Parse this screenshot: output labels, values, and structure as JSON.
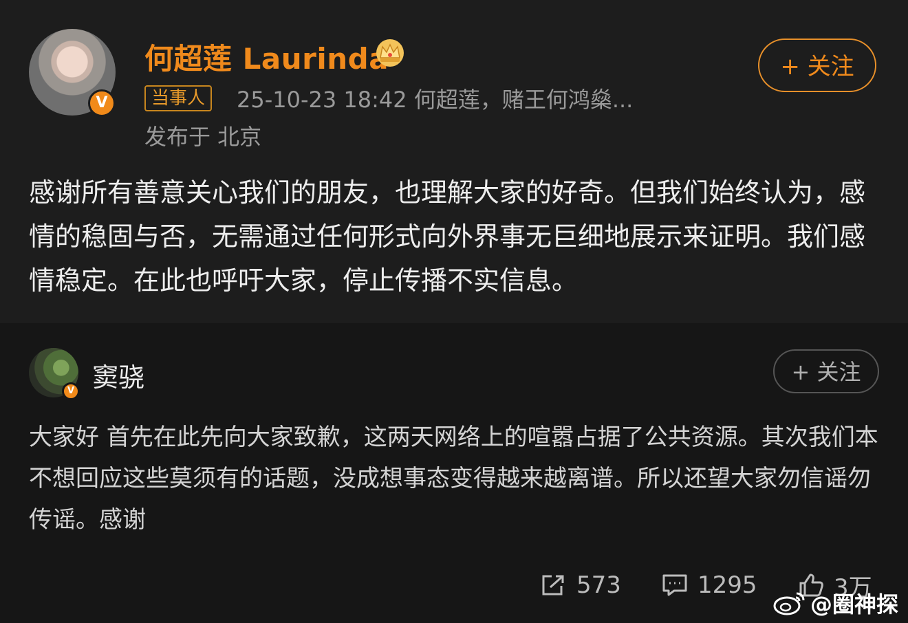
{
  "post": {
    "author_name": "何超莲 Laurinda",
    "tag": "当事人",
    "meta": "25-10-23 18:42  何超莲，赌王何鸿燊...",
    "location": "发布于 北京",
    "follow_label": "+ 关注",
    "text": "感谢所有善意关心我们的朋友，也理解大家的好奇。但我们始终认为，感情的稳固与否，无需通过任何形式向外界事无巨细地展示来证明。我们感情稳定。在此也呼吁大家，停止传播不实信息。",
    "verified_badge": "V",
    "accent_color": "#f08a1c"
  },
  "repost": {
    "author_name": "窦骁",
    "follow_label": "+ 关注",
    "verified_badge": "V",
    "text": "大家好 首先在此先向大家致歉，这两天网络上的喧嚣占据了公共资源。其次我们本不想回应这些莫须有的话题，没成想事态变得越来越离谱。所以还望大家勿信谣勿传谣。感谢"
  },
  "actions": {
    "share_count": "573",
    "comment_count": "1295",
    "like_count": "3万",
    "share_icon": "share-icon",
    "comment_icon": "comment-icon",
    "like_icon": "thumbs-up-icon"
  },
  "watermark": {
    "text": "@圈神探",
    "icon": "weibo-logo-icon"
  }
}
